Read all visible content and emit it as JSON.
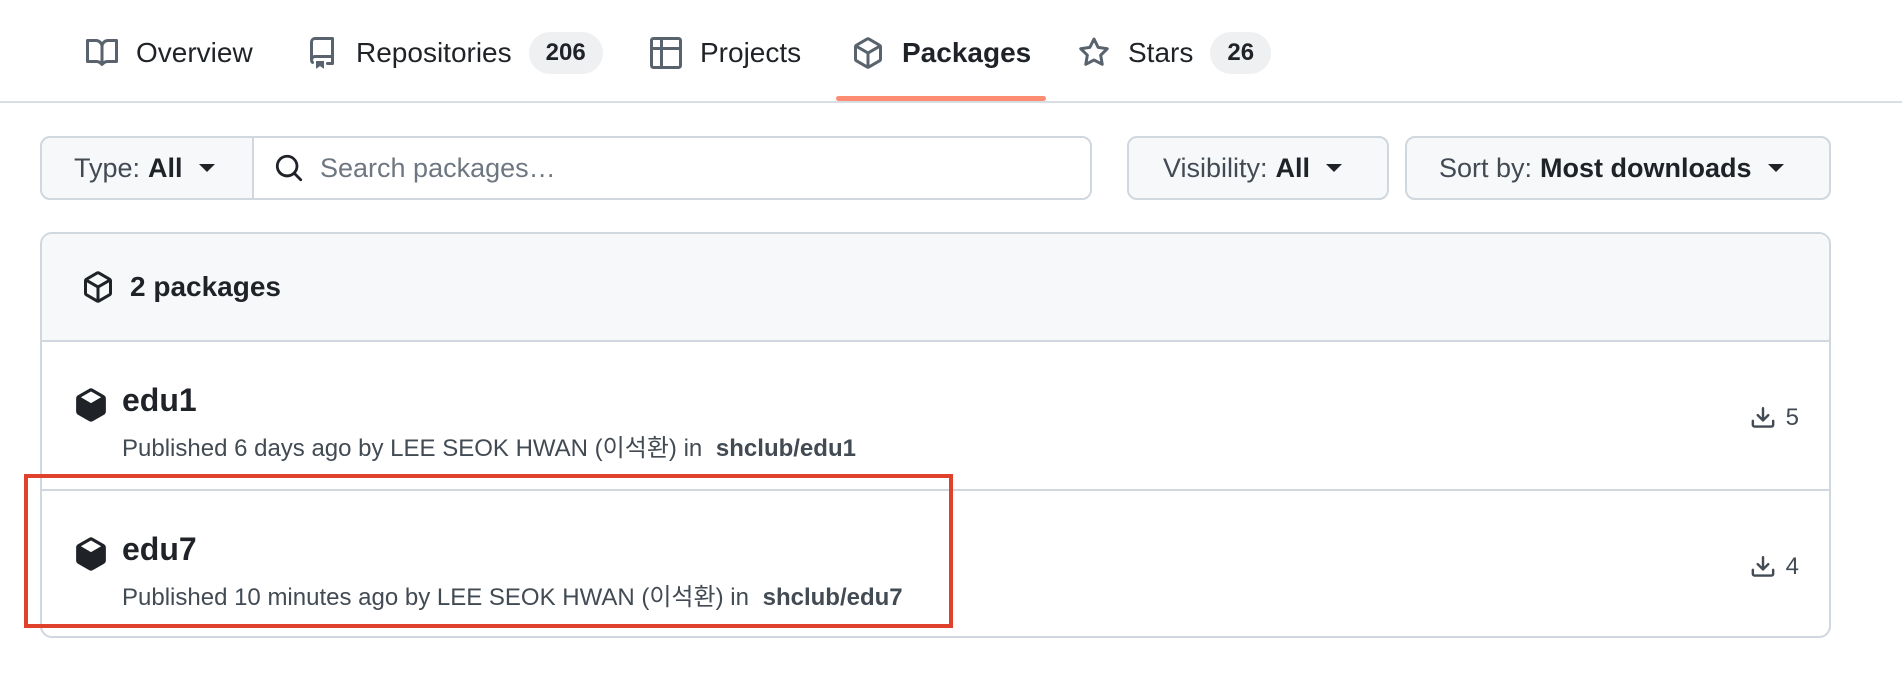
{
  "tabs": [
    {
      "label": "Overview",
      "icon": "book-icon",
      "counter": null
    },
    {
      "label": "Repositories",
      "icon": "repo-icon",
      "counter": "206"
    },
    {
      "label": "Projects",
      "icon": "table-icon",
      "counter": null
    },
    {
      "label": "Packages",
      "icon": "package-icon",
      "counter": null,
      "selected": true
    },
    {
      "label": "Stars",
      "icon": "star-icon",
      "counter": "26"
    }
  ],
  "filters": {
    "type_label": "Type:",
    "type_value": "All",
    "search_placeholder": "Search packages…",
    "visibility_label": "Visibility:",
    "visibility_value": "All",
    "sort_label": "Sort by:",
    "sort_value": "Most downloads"
  },
  "list": {
    "header": "2 packages",
    "packages": [
      {
        "name": "edu1",
        "published": "Published 6 days ago by LEE SEOK HWAN (이석환) in",
        "repo": "shclub/edu1",
        "downloads": "5"
      },
      {
        "name": "edu7",
        "published": "Published 10 minutes ago by LEE SEOK HWAN (이석환) in",
        "repo": "shclub/edu7",
        "downloads": "4"
      }
    ]
  },
  "colors": {
    "accent_underline": "#fd8c73",
    "highlight_box": "#e0412c"
  }
}
